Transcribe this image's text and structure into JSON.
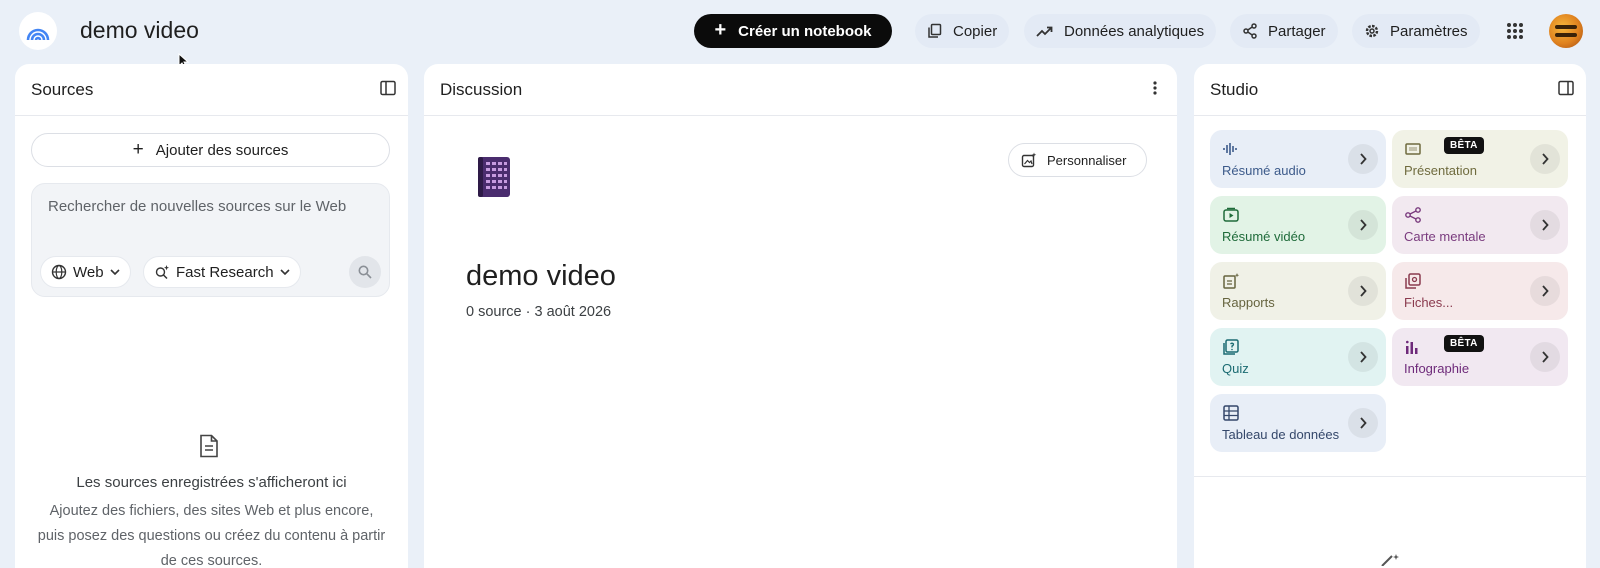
{
  "header": {
    "notebook_title": "demo video",
    "create_label": "Créer un notebook",
    "copy_label": "Copier",
    "analytics_label": "Données analytiques",
    "share_label": "Partager",
    "settings_label": "Paramètres"
  },
  "sources": {
    "title": "Sources",
    "add_label": "Ajouter des sources",
    "search_placeholder": "Rechercher de nouvelles sources sur le Web",
    "web_chip": "Web",
    "research_chip": "Fast Research",
    "empty_title": "Les sources enregistrées s'afficheront ici",
    "empty_desc": "Ajoutez des fichiers, des sites Web et plus encore, puis posez des questions ou créez du contenu à partir de ces sources."
  },
  "discussion": {
    "title": "Discussion",
    "customize_label": "Personnaliser",
    "notebook_title": "demo video",
    "meta": "0 source · 3 août 2026"
  },
  "studio": {
    "title": "Studio",
    "beta_label": "BÊTA",
    "tiles": [
      {
        "label": "Résumé audio",
        "icon": "audio-icon",
        "color": "#3c5a8a",
        "bg": "#e8eef7",
        "beta": false
      },
      {
        "label": "Présentation",
        "icon": "slides-icon",
        "color": "#6f6b3e",
        "bg": "#f1f2e6",
        "beta": true
      },
      {
        "label": "Résumé vidéo",
        "icon": "video-icon",
        "color": "#1f6b3a",
        "bg": "#e2f3e6",
        "beta": false
      },
      {
        "label": "Carte mentale",
        "icon": "mindmap-icon",
        "color": "#7a3b7e",
        "bg": "#f2e9f0",
        "beta": false
      },
      {
        "label": "Rapports",
        "icon": "report-icon",
        "color": "#66643f",
        "bg": "#f0f1e7",
        "beta": false
      },
      {
        "label": "Fiches...",
        "icon": "flashcards-icon",
        "color": "#8a3a4e",
        "bg": "#f6e9ea",
        "beta": false
      },
      {
        "label": "Quiz",
        "icon": "quiz-icon",
        "color": "#1b6b72",
        "bg": "#e1f3f2",
        "beta": false
      },
      {
        "label": "Infographie",
        "icon": "infographic-icon",
        "color": "#6e2a7a",
        "bg": "#f1e8f1",
        "beta": true
      },
      {
        "label": "Tableau de données",
        "icon": "table-icon",
        "color": "#34476a",
        "bg": "#e8eef7",
        "beta": false
      }
    ]
  }
}
